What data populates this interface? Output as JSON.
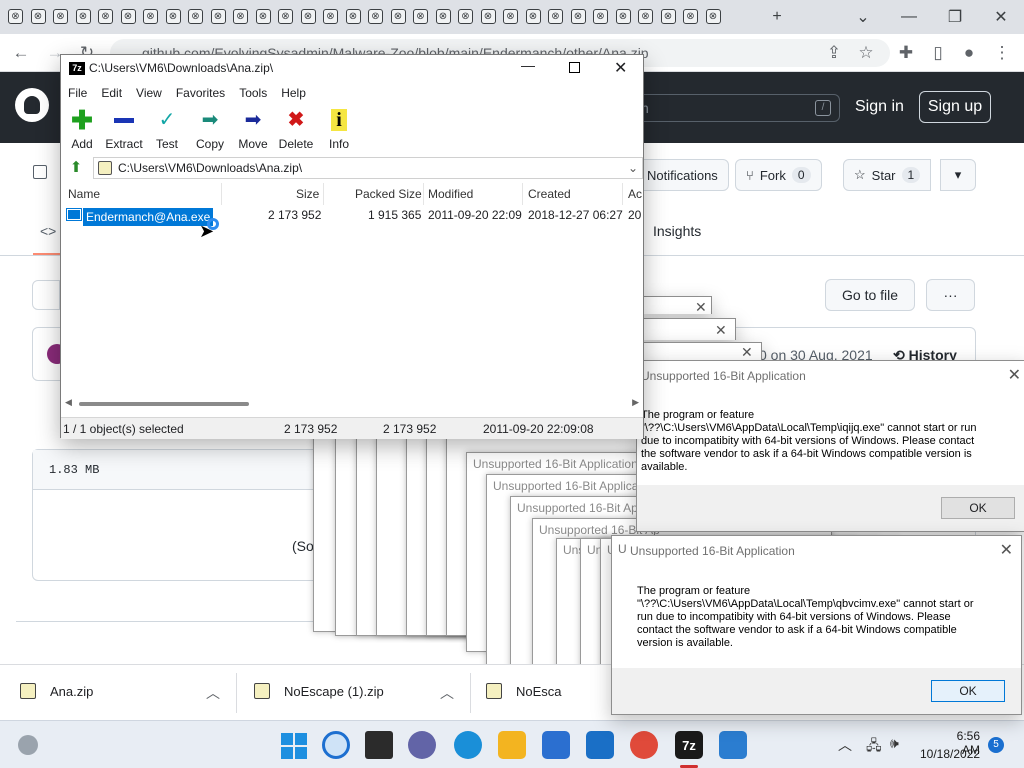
{
  "browser": {
    "tab_count_visible": 32,
    "url": "github.com/EvolvingSysadmin/Malware-Zoo/blob/main/Endermanch/other/Ana.zip",
    "new_tab_icon": "plus-icon",
    "minimize_icon": "minimize-icon",
    "restore_icon": "restore-icon",
    "close_icon": "close-icon"
  },
  "github": {
    "search_placeholder": "h",
    "search_hint": "/",
    "signin": "Sign in",
    "signup": "Sign up",
    "notifications": "Notifications",
    "fork": "Fork",
    "fork_count": "0",
    "star": "Star",
    "star_count": "1",
    "insights": "Insights",
    "go_to_file": "Go to file",
    "more": "···",
    "commit_date": "0 on 30 Aug, 2021",
    "history": "History",
    "file_size": "1.83 MB",
    "sorry_text": "(Sorry about that, b"
  },
  "zip": {
    "title": "C:\\Users\\VM6\\Downloads\\Ana.zip\\",
    "menu": [
      "File",
      "Edit",
      "View",
      "Favorites",
      "Tools",
      "Help"
    ],
    "tools": {
      "add": "Add",
      "extract": "Extract",
      "test": "Test",
      "copy": "Copy",
      "move": "Move",
      "delete": "Delete",
      "info": "Info"
    },
    "address": "C:\\Users\\VM6\\Downloads\\Ana.zip\\",
    "columns": {
      "name": "Name",
      "size": "Size",
      "packed": "Packed Size",
      "modified": "Modified",
      "created": "Created",
      "accessed": "Ac"
    },
    "row": {
      "name": "Endermanch@Ana.exe",
      "size": "2 173 952",
      "packed": "1 915 365",
      "modified": "2011-09-20 22:09",
      "created": "2018-12-27 06:27",
      "accessed": "20"
    },
    "status": {
      "selected": "1 / 1 object(s) selected",
      "size1": "2 173 952",
      "size2": "2 173 952",
      "date": "2011-09-20 22:09:08"
    }
  },
  "dialog_bg": {
    "title": "Unsupported 16-Bit Application",
    "line1": "The program or feature",
    "line2": "\"\\??\\C:\\Users\\VM6\\AppData\\Local\\Temp\\iqijq.exe\" cannot start or run",
    "line3": "due to incompatibity with 64-bit versions of Windows. Please contact",
    "line4": "the software vendor to ask if a 64-bit Windows compatible version is",
    "line5": "available.",
    "ok": "OK"
  },
  "dialog_front": {
    "title": "Unsupported 16-Bit Application",
    "line1": "The program or feature",
    "line2": "\"\\??\\C:\\Users\\VM6\\AppData\\Local\\Temp\\qbvcimv.exe\" cannot start or",
    "line3": "run due to incompatibity with 64-bit versions of Windows. Please",
    "line4": "contact the software vendor to ask if a 64-bit Windows compatible",
    "line5": "version is available.",
    "ok": "OK"
  },
  "stack_titles": [
    "Unsupported 16-Bit Application",
    "Unsupported 16-Bit Application",
    "Unsupported 16-Bit Application",
    "Unsupported 16-Bit Ap",
    "Unsupported 16-Bit Ap",
    "Un",
    "U"
  ],
  "downloads": {
    "item1": "Ana.zip",
    "item2": "NoEscape (1).zip",
    "item3": "NoEsca"
  },
  "taskbar": {
    "time": "6:56 AM",
    "date": "10/18/2022",
    "notifications": "5",
    "zip_label": "7z"
  }
}
